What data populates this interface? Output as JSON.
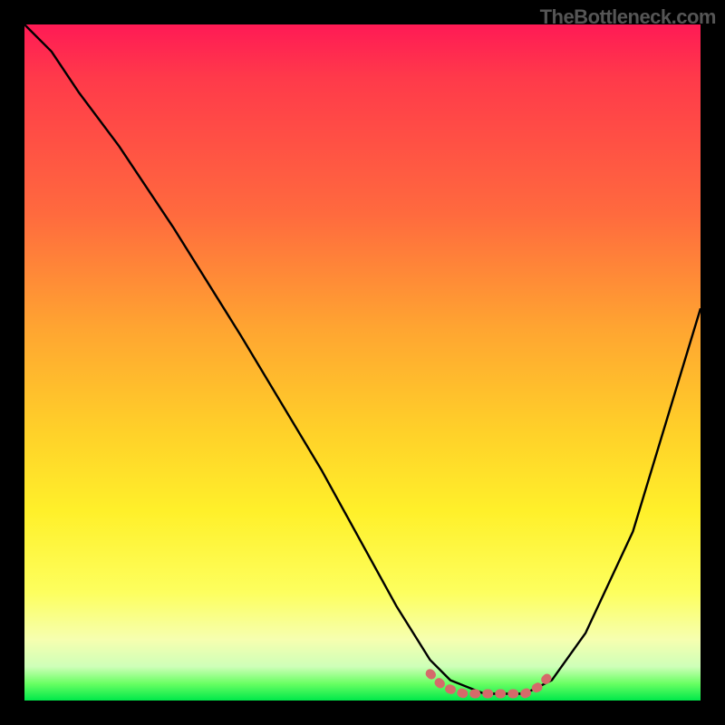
{
  "watermark": "TheBottleneck.com",
  "chart_data": {
    "type": "line",
    "title": "",
    "xlabel": "",
    "ylabel": "",
    "xlim": [
      0,
      100
    ],
    "ylim": [
      0,
      100
    ],
    "grid": false,
    "legend": false,
    "background_gradient": {
      "direction": "vertical",
      "stops": [
        {
          "pos": 0,
          "color": "#ff1a55"
        },
        {
          "pos": 28,
          "color": "#ff6a3e"
        },
        {
          "pos": 60,
          "color": "#ffd029"
        },
        {
          "pos": 84,
          "color": "#fdff5e"
        },
        {
          "pos": 95,
          "color": "#ceffb8"
        },
        {
          "pos": 100,
          "color": "#00e84a"
        }
      ]
    },
    "series": [
      {
        "name": "bottleneck-curve",
        "color": "#000000",
        "x": [
          0,
          4,
          8,
          14,
          22,
          32,
          44,
          55,
          60,
          63,
          68,
          74,
          78,
          83,
          90,
          100
        ],
        "y": [
          100,
          96,
          90,
          82,
          70,
          54,
          34,
          14,
          6,
          3,
          1,
          1,
          3,
          10,
          25,
          58
        ]
      }
    ],
    "highlight_band": {
      "name": "minimum-region",
      "color": "#d56a6a",
      "x": [
        60,
        62,
        65,
        68,
        70,
        72,
        74,
        76,
        78
      ],
      "y": [
        4,
        2,
        1,
        1,
        1,
        1,
        1,
        2,
        4
      ]
    }
  }
}
